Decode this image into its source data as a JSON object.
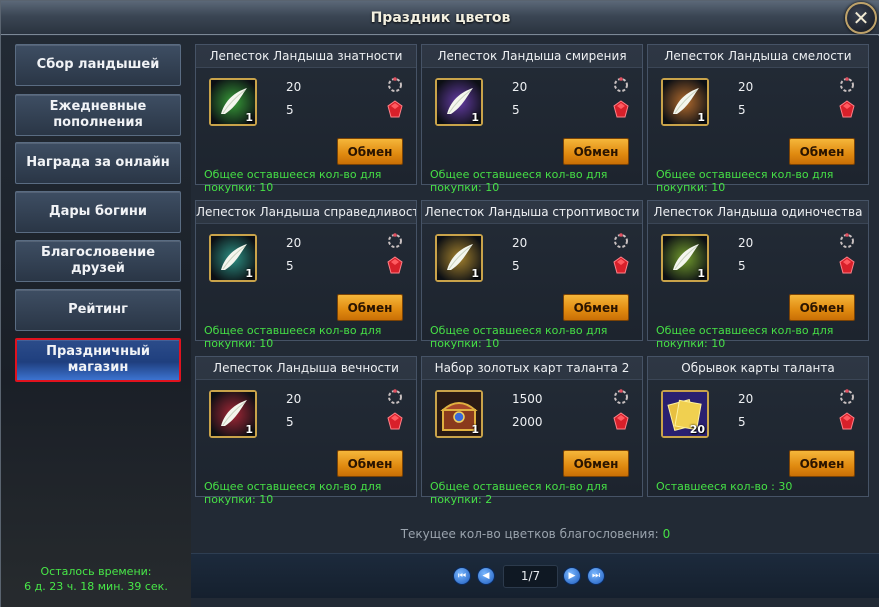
{
  "window": {
    "title": "Праздник цветов"
  },
  "sidebar": {
    "items": [
      {
        "label": "Сбор ландышей"
      },
      {
        "label": "Ежедневные пополнения"
      },
      {
        "label": "Награда за онлайн"
      },
      {
        "label": "Дары богини"
      },
      {
        "label": "Благословение друзей"
      },
      {
        "label": "Рейтинг"
      },
      {
        "label": "Праздничный магазин",
        "active": true
      }
    ],
    "timer_label": "Осталось времени:",
    "timer_value": "6 д. 23 ч. 18 мин. 39 сек."
  },
  "shop": {
    "exchange_label": "Обмен",
    "items": [
      {
        "title": "Лепесток Ландыша знатности",
        "count": "1",
        "icon": "petal-icon",
        "color": "#3aa83a",
        "price1": "20",
        "price2": "5",
        "remain": "Общее оставшееся кол-во для покупки: 10"
      },
      {
        "title": "Лепесток Ландыша смирения",
        "count": "1",
        "icon": "petal-icon",
        "color": "#6b3fb0",
        "price1": "20",
        "price2": "5",
        "remain": "Общее оставшееся кол-во для покупки: 10"
      },
      {
        "title": "Лепесток Ландыша смелости",
        "count": "1",
        "icon": "petal-icon",
        "color": "#c0722e",
        "price1": "20",
        "price2": "5",
        "remain": "Общее оставшееся кол-во для покупки: 10"
      },
      {
        "title": "Лепесток Ландыша справедливости",
        "count": "1",
        "icon": "petal-icon",
        "color": "#2e9a8c",
        "price1": "20",
        "price2": "5",
        "remain": "Общее оставшееся кол-во для покупки: 10"
      },
      {
        "title": "Лепесток Ландыша строптивости",
        "count": "1",
        "icon": "petal-icon",
        "color": "#b08a2e",
        "price1": "20",
        "price2": "5",
        "remain": "Общее оставшееся кол-во для покупки: 10"
      },
      {
        "title": "Лепесток Ландыша одиночества",
        "count": "1",
        "icon": "petal-icon",
        "color": "#7aa82e",
        "price1": "20",
        "price2": "5",
        "remain": "Общее оставшееся кол-во для покупки: 10"
      },
      {
        "title": "Лепесток Ландыша вечности",
        "count": "1",
        "icon": "petal-icon",
        "color": "#b02838",
        "price1": "20",
        "price2": "5",
        "remain": "Общее оставшееся кол-во для покупки: 10"
      },
      {
        "title": "Набор золотых карт таланта 2",
        "count": "1",
        "icon": "treasure-chest-icon",
        "color": "#8a3a1c",
        "price1": "1500",
        "price2": "2000",
        "remain": "Общее оставшееся кол-во для покупки: 2"
      },
      {
        "title": "Обрывок карты таланта",
        "count": "20",
        "icon": "talent-card-icon",
        "color": "#3a2a8a",
        "price1": "20",
        "price2": "5",
        "remain": "Оставшееся кол-во : 30"
      }
    ],
    "currency_icons": [
      "flower-wreath-icon",
      "ruby-icon"
    ]
  },
  "footer": {
    "total_label": "Текущее кол-во цветков благословения:",
    "total_value": "0"
  },
  "pager": {
    "page": "1/7"
  },
  "colors": {
    "accent_orange": "#e08a10",
    "green_text": "#46e046",
    "active_border": "#e0121e"
  }
}
